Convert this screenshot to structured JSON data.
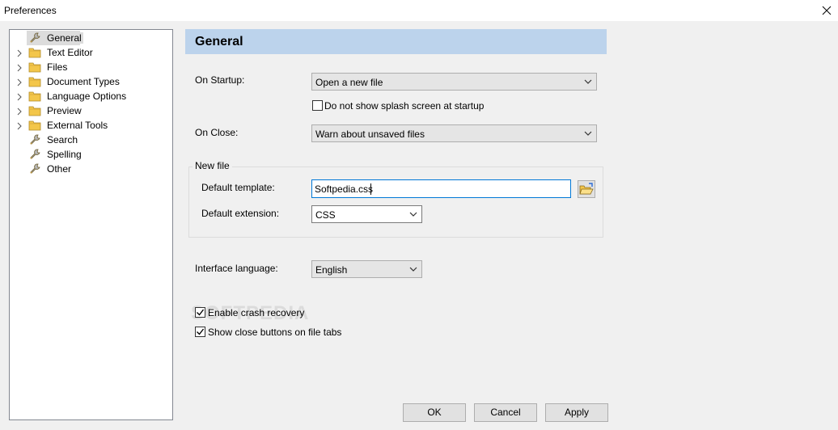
{
  "window": {
    "title": "Preferences"
  },
  "tree": {
    "items": [
      {
        "label": "General",
        "expandable": false,
        "icon": "wrench-icon",
        "selected": true
      },
      {
        "label": "Text Editor",
        "expandable": true,
        "icon": "folder-icon"
      },
      {
        "label": "Files",
        "expandable": true,
        "icon": "folder-icon"
      },
      {
        "label": "Document Types",
        "expandable": true,
        "icon": "folder-icon"
      },
      {
        "label": "Language Options",
        "expandable": true,
        "icon": "folder-icon"
      },
      {
        "label": "Preview",
        "expandable": true,
        "icon": "folder-icon"
      },
      {
        "label": "External Tools",
        "expandable": true,
        "icon": "folder-icon"
      },
      {
        "label": "Search",
        "expandable": false,
        "icon": "wrench-icon"
      },
      {
        "label": "Spelling",
        "expandable": false,
        "icon": "wrench-icon"
      },
      {
        "label": "Other",
        "expandable": false,
        "icon": "wrench-icon"
      }
    ]
  },
  "panel": {
    "title": "General",
    "on_startup": {
      "label": "On Startup:",
      "value": "Open a new file"
    },
    "splash": {
      "label": "Do not show splash screen at startup",
      "checked": false
    },
    "on_close": {
      "label": "On Close:",
      "value": "Warn about unsaved files"
    },
    "new_file": {
      "title": "New file",
      "template_label": "Default template:",
      "template_value": "Softpedia.css",
      "extension_label": "Default extension:",
      "extension_value": "CSS"
    },
    "language": {
      "label": "Interface language:",
      "value": "English"
    },
    "crash_recovery": {
      "label": "Enable crash recovery",
      "checked": true
    },
    "close_buttons": {
      "label": "Show close buttons on file tabs",
      "checked": true
    }
  },
  "buttons": {
    "ok": "OK",
    "cancel": "Cancel",
    "apply": "Apply"
  },
  "watermark": "SOFTPEDIA",
  "colors": {
    "header_band": "#bcd3ec",
    "focus_border": "#0078d7"
  }
}
